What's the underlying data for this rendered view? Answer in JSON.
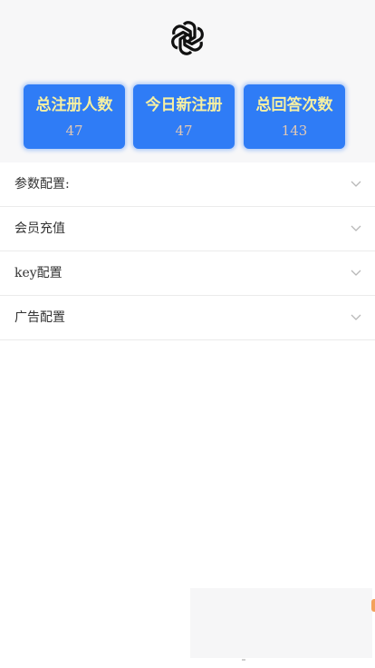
{
  "header": {
    "logo_icon": "openai-logo-icon"
  },
  "stats": [
    {
      "label": "总注册人数",
      "value": "47"
    },
    {
      "label": "今日新注册",
      "value": "47"
    },
    {
      "label": "总回答次数",
      "value": "143"
    }
  ],
  "menu": {
    "items": [
      {
        "label": "参数配置:",
        "icon": "chevron-down-icon"
      },
      {
        "label": "会员充值",
        "icon": "chevron-down-icon"
      },
      {
        "label": "key配置",
        "icon": "chevron-down-icon"
      },
      {
        "label": "广告配置",
        "icon": "chevron-down-icon"
      }
    ]
  },
  "colors": {
    "card_bg": "#2f7cf6",
    "card_label": "#f7f0a2",
    "card_value": "#e2c8b4",
    "header_bg": "#f7f7f8"
  }
}
